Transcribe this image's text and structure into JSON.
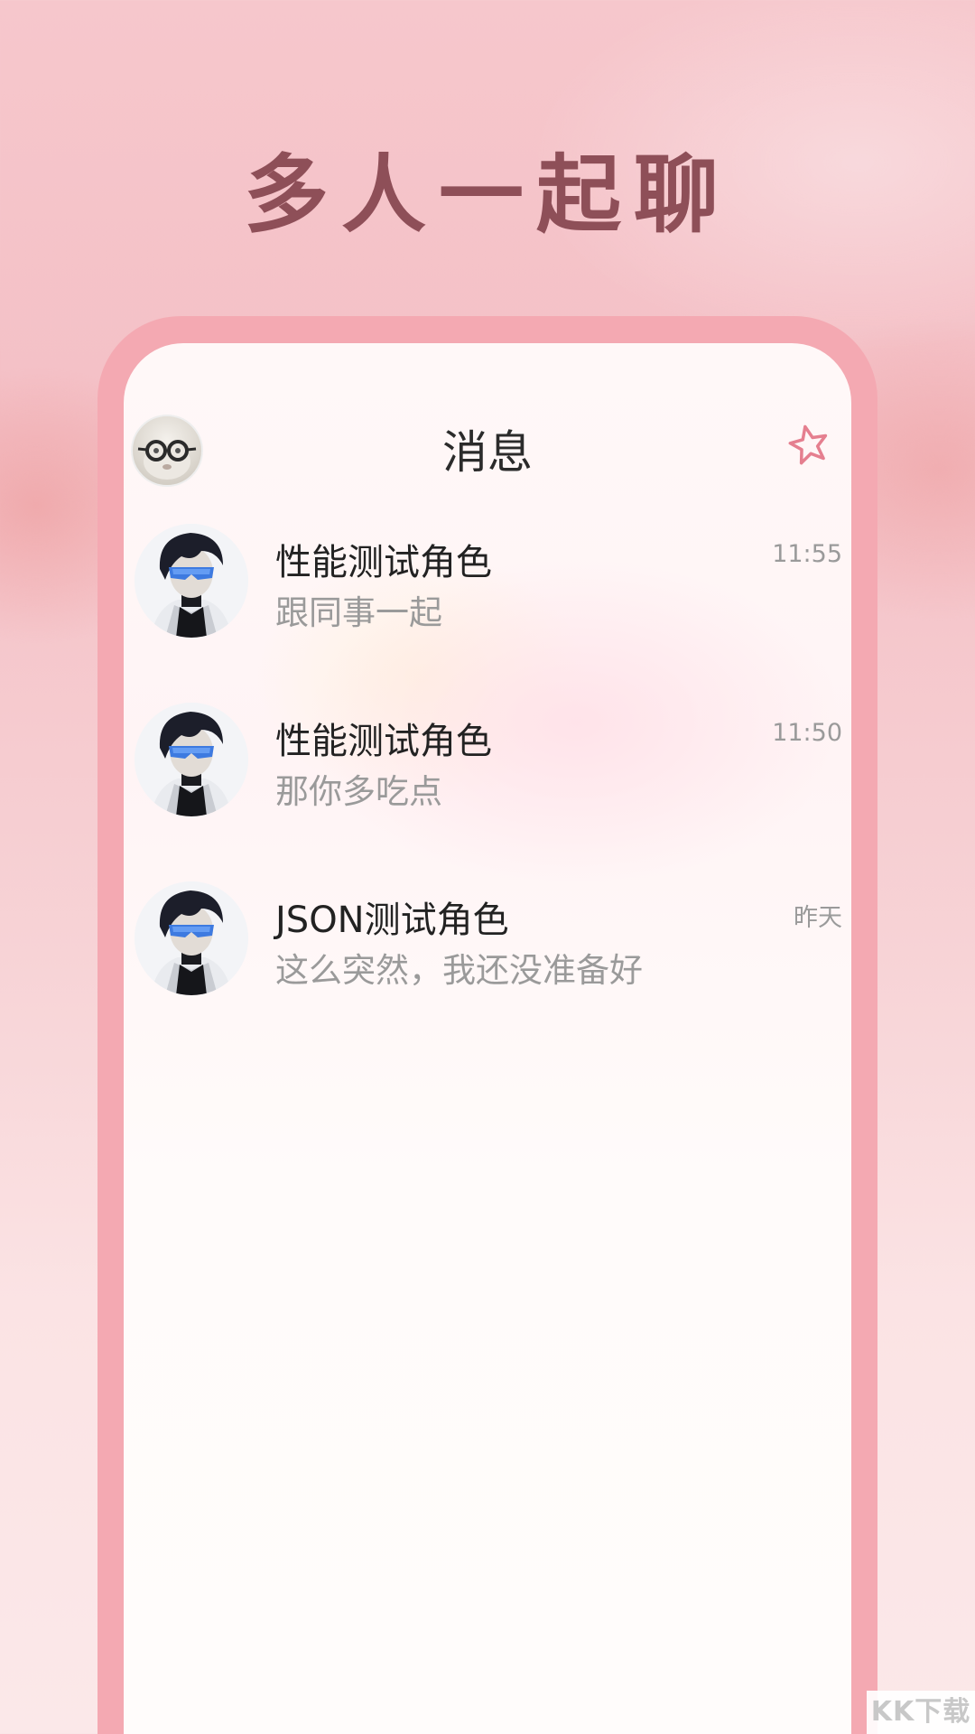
{
  "headline": "多人一起聊",
  "header": {
    "title": "消息",
    "avatar_icon": "user-avatar",
    "star_icon": "star-outline-icon"
  },
  "chats": [
    {
      "name": "性能测试角色",
      "preview": "跟同事一起",
      "time": "11:55"
    },
    {
      "name": "性能测试角色",
      "preview": "那你多吃点",
      "time": "11:50"
    },
    {
      "name": "JSON测试角色",
      "preview": "这么突然，我还没准备好",
      "time": "昨天"
    }
  ],
  "watermark": "KK下载",
  "colors": {
    "accent": "#f4a9b2",
    "headline": "#8e4f58",
    "icon": "#e57f8f"
  }
}
